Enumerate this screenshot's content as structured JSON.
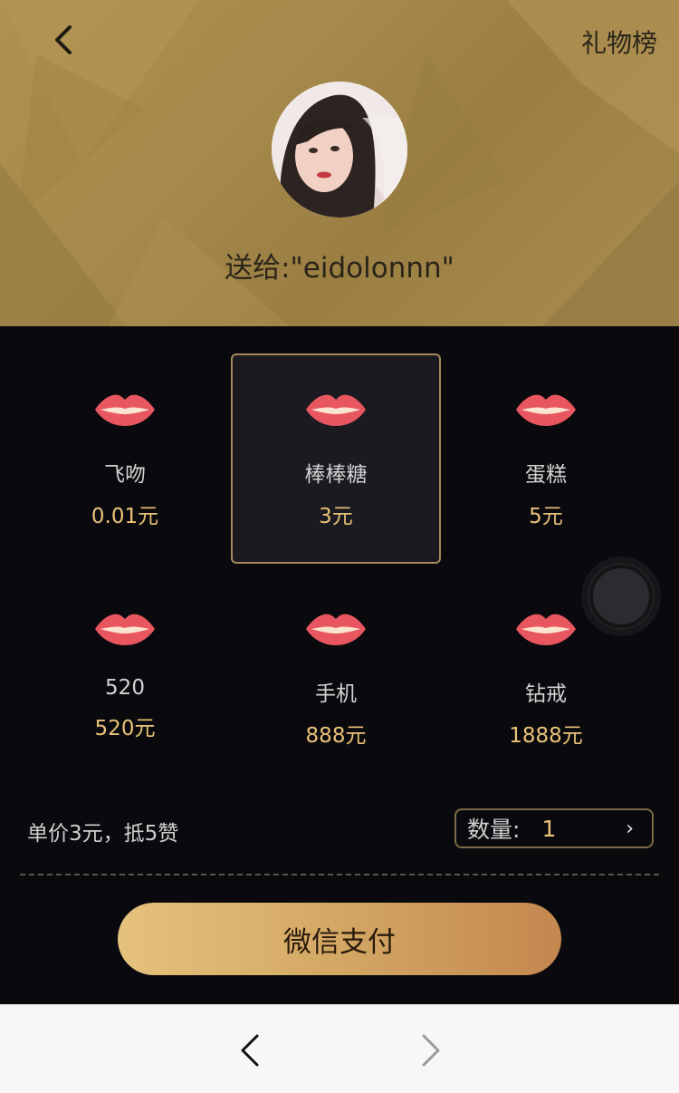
{
  "header": {
    "rank_label": "礼物榜",
    "send_to": "送给:\"eidolonnn\""
  },
  "gifts": [
    {
      "name": "飞吻",
      "price": "0.01元",
      "selected": false
    },
    {
      "name": "棒棒糖",
      "price": "3元",
      "selected": true
    },
    {
      "name": "蛋糕",
      "price": "5元",
      "selected": false
    },
    {
      "name": "520",
      "price": "520元",
      "selected": false
    },
    {
      "name": "手机",
      "price": "888元",
      "selected": false
    },
    {
      "name": "钻戒",
      "price": "1888元",
      "selected": false
    }
  ],
  "purchase": {
    "unit_price_text": "单价3元，抵5赞",
    "quantity_label": "数量:",
    "quantity_value": "1",
    "pay_label": "微信支付"
  },
  "icons": {
    "back": "chevron-left-icon",
    "gift": "lips-icon",
    "forward": "chevron-right-icon"
  },
  "colors": {
    "header_gold": "#a68a4c",
    "price_gold": "#e9c278",
    "selected_border": "#a4875a",
    "pay_gradient_start": "#e5c27c",
    "pay_gradient_end": "#c4874f"
  }
}
